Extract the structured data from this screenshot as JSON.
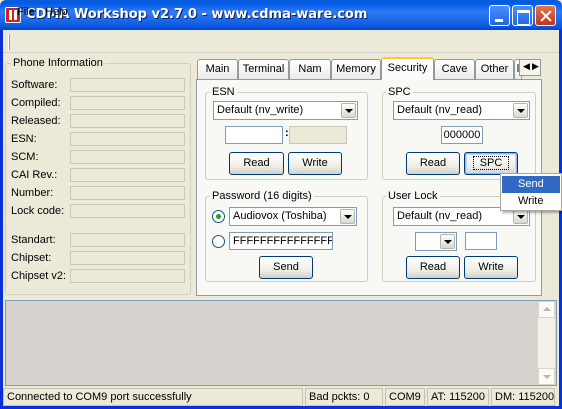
{
  "window": {
    "title": "CDMA Workshop v2.7.0  -  www.cdma-ware.com"
  },
  "menu": {
    "file": "File",
    "help": "Help"
  },
  "phone_info": {
    "title": "Phone Information",
    "fields": [
      {
        "label": "Software:",
        "value": ""
      },
      {
        "label": "Compiled:",
        "value": ""
      },
      {
        "label": "Released:",
        "value": ""
      },
      {
        "label": "ESN:",
        "value": ""
      },
      {
        "label": "SCM:",
        "value": ""
      },
      {
        "label": "CAI Rev.:",
        "value": ""
      },
      {
        "label": "Number:",
        "value": ""
      },
      {
        "label": "Lock code:",
        "value": ""
      }
    ],
    "fields2": [
      {
        "label": "Standart:",
        "value": ""
      },
      {
        "label": "Chipset:",
        "value": ""
      },
      {
        "label": "Chipset v2:",
        "value": ""
      }
    ]
  },
  "tabs": [
    "Main",
    "Terminal",
    "Nam",
    "Memory",
    "Security",
    "Cave",
    "Other",
    "l"
  ],
  "active_tab": "Security",
  "esn": {
    "title": "ESN",
    "mode": "Default (nv_write)",
    "value1": "",
    "separator": ":",
    "value2": "",
    "read": "Read",
    "write": "Write"
  },
  "spc": {
    "title": "SPC",
    "mode": "Default (nv_read)",
    "code": "000000",
    "read": "Read",
    "spc_button": "SPC"
  },
  "password": {
    "title": "Password (16 digits)",
    "option1": "Audiovox (Toshiba)",
    "option1_selected": true,
    "option2_value": "FFFFFFFFFFFFFFFF",
    "send": "Send"
  },
  "user_lock": {
    "title": "User Lock",
    "mode": "Default (nv_read)",
    "small_combo": "",
    "code": "",
    "read": "Read",
    "write": "Write"
  },
  "context_menu": {
    "items": [
      "Send",
      "Write"
    ],
    "highlighted": "Send"
  },
  "status": {
    "message": "Connected to COM9 port successfully",
    "bad_packets": "Bad pckts: 0",
    "port": "COM9",
    "at": "AT: 115200",
    "dm": "DM: 115200"
  }
}
